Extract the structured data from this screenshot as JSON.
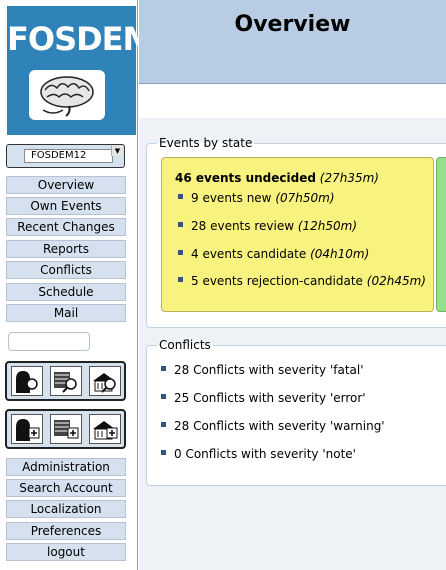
{
  "logo": {
    "text": "FOSDEM",
    "color": "#2f83b8"
  },
  "conference_select": {
    "value": "FOSDEM12"
  },
  "nav_items": [
    "Overview",
    "Own Events",
    "Recent Changes",
    "Reports",
    "Conflicts",
    "Schedule",
    "Mail"
  ],
  "admin_items": [
    "Administration",
    "Search Account",
    "Localization",
    "Preferences",
    "logout"
  ],
  "search": {
    "placeholder": ""
  },
  "page": {
    "title": "Overview"
  },
  "events_by_state": {
    "legend": "Events by state",
    "undecided_count": "46 events undecided",
    "undecided_duration": "(27h35m)",
    "items": [
      {
        "label": "9 events new",
        "duration": "(07h50m)"
      },
      {
        "label": "28 events review",
        "duration": "(12h50m)"
      },
      {
        "label": "4 events candidate",
        "duration": "(04h10m)"
      },
      {
        "label": "5 events rejection-candidate",
        "duration": "(02h45m)"
      }
    ],
    "colors": {
      "undecided": "#f8f27e",
      "accepted": "#93e089"
    }
  },
  "conflicts": {
    "legend": "Conflicts",
    "items": [
      "28 Conflicts with severity 'fatal'",
      "25 Conflicts with severity 'error'",
      "28 Conflicts with severity 'warning'",
      "0 Conflicts with severity 'note'"
    ]
  }
}
